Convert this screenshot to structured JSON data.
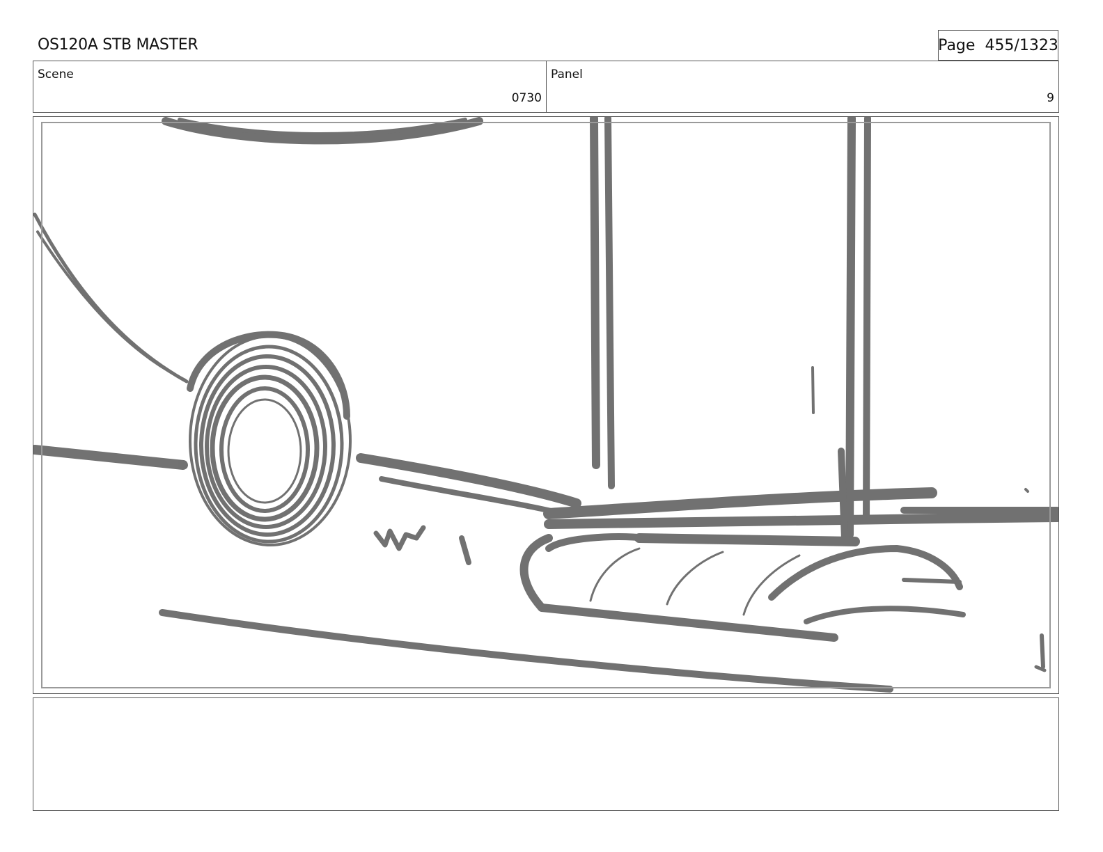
{
  "header": {
    "doc_title": "OS120A STB MASTER",
    "page_label": "Page",
    "page_number": "455/1323"
  },
  "info": {
    "scene_label": "Scene",
    "scene_value": "0730",
    "panel_label": "Panel",
    "panel_value": "9"
  },
  "frame": {
    "sketch_description_icon": "rough-storyboard-sketch",
    "stroke_color": "#6a6a6a"
  },
  "notes": {
    "text": ""
  }
}
